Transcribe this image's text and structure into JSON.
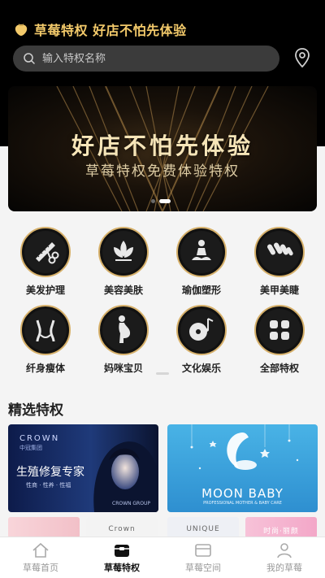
{
  "header": {
    "app_title": "草莓特权  好店不怕先体验",
    "logo_icon": "strawberry-logo-icon",
    "location_icon": "location-pin-icon"
  },
  "search": {
    "placeholder": "输入特权名称",
    "value": ""
  },
  "banner": {
    "title": "好店不怕先体验",
    "subtitle": "草莓特权免费体验特权",
    "slide_count": 2,
    "active_slide": 2
  },
  "categories": [
    {
      "label": "美发护理",
      "icon": "comb-scissors-icon"
    },
    {
      "label": "美容美肤",
      "icon": "lotus-icon"
    },
    {
      "label": "瑜伽塑形",
      "icon": "yoga-icon"
    },
    {
      "label": "美甲美睫",
      "icon": "nails-icon"
    },
    {
      "label": "纤身瘦体",
      "icon": "body-slim-icon"
    },
    {
      "label": "妈咪宝贝",
      "icon": "pregnant-icon"
    },
    {
      "label": "文化娱乐",
      "icon": "music-disc-icon"
    },
    {
      "label": "全部特权",
      "icon": "all-grid-icon"
    }
  ],
  "section": {
    "title": "精选特权"
  },
  "featured": {
    "crown": {
      "logo": "CROWN",
      "logo_sub": "中冠集团",
      "title": "生殖修复专家",
      "tags": "性商 · 性养 · 性福",
      "footer": "CROWN GROUP"
    },
    "moon": {
      "title": "MOON BABY",
      "subtitle": "PROFESSIONAL MOTHER & BABY CARE"
    }
  },
  "thumbs": [
    {
      "text": ""
    },
    {
      "text": "Crown"
    },
    {
      "text": "UNIQUE"
    },
    {
      "text": "时尚·丽颜"
    }
  ],
  "tabbar": [
    {
      "label": "草莓首页",
      "icon": "home-icon",
      "active": false
    },
    {
      "label": "草莓特权",
      "icon": "privilege-box-icon",
      "active": true
    },
    {
      "label": "草莓空间",
      "icon": "card-space-icon",
      "active": false
    },
    {
      "label": "我的草莓",
      "icon": "user-icon",
      "active": false
    }
  ],
  "colors": {
    "accent_gold": "#f2c96a",
    "header_bg": "#000000",
    "tab_active": "#111111",
    "tab_inactive": "#999999"
  }
}
